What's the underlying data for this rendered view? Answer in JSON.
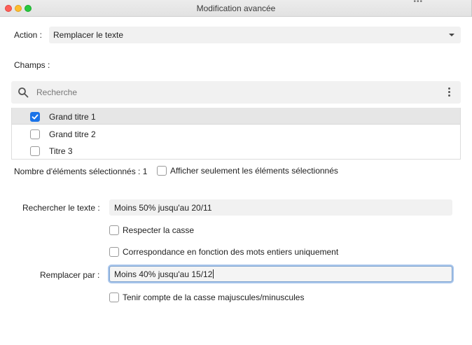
{
  "window": {
    "title": "Modification avancée",
    "edge_glyph": "•••"
  },
  "action": {
    "label": "Action :",
    "selected": "Remplacer le texte"
  },
  "fields": {
    "label": "Champs :",
    "search_placeholder": "Recherche",
    "items": [
      {
        "label": "Grand titre 1",
        "checked": true
      },
      {
        "label": "Grand titre 2",
        "checked": false
      },
      {
        "label": "Titre 3",
        "checked": false
      }
    ],
    "count_text": "Nombre d'éléments sélectionnés : 1",
    "show_selected_label": "Afficher seulement les éléments sélectionnés"
  },
  "find": {
    "label": "Rechercher le texte :",
    "value": "Moins 50% jusqu'au 20/11",
    "match_case_label": "Respecter la casse",
    "whole_words_label": "Correspondance en fonction des mots entiers uniquement"
  },
  "replace": {
    "label": "Remplacer par :",
    "value": "Moins 40% jusqu'au 15/12",
    "preserve_case_label": "Tenir compte de la casse majuscules/minuscules"
  },
  "colors": {
    "accent": "#1a73e8",
    "field_bg": "#f1f1f1",
    "focus_ring": "#a9c6ec"
  },
  "icons": {
    "search": "search-icon",
    "more": "more-vertical-icon",
    "dropdown": "chevron-down-icon",
    "check": "check-icon"
  }
}
